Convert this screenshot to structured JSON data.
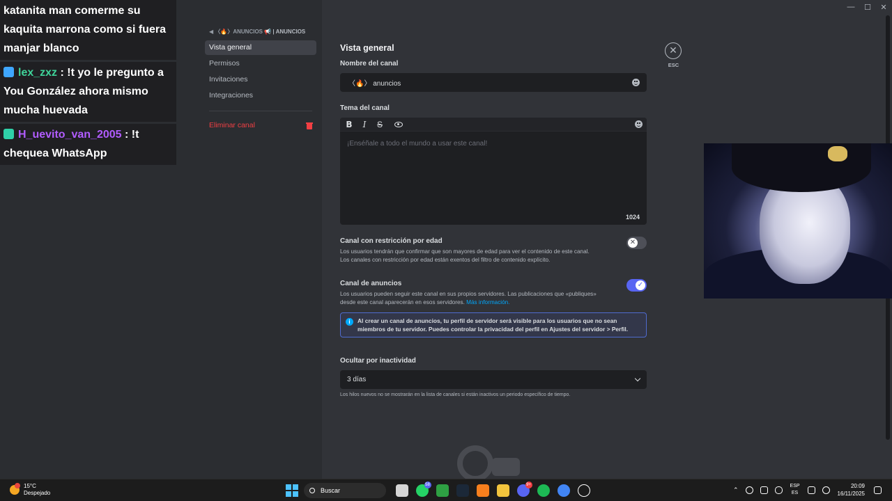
{
  "chat": [
    {
      "user": "",
      "user_color": "#ffffff",
      "badge_color": "",
      "text": "katanita man comerme su kaquita marrona como si fuera manjar blanco"
    },
    {
      "user": "lex_zxz",
      "user_color": "#3fd49a",
      "badge_color": "#3fa7ff",
      "text": "!t yo le pregunto a You González ahora mismo mucha huevada"
    },
    {
      "user": "H_uevito_van_2005",
      "user_color": "#b15cff",
      "badge_color": "#2fd1a8",
      "text": "!t chequea WhatsApp"
    }
  ],
  "sidebar": {
    "category_prefix": "◀ 〈🔥〉ANUNCIOS",
    "category_channel": "📢 | ANUNCIOS",
    "items": [
      {
        "label": "Vista general",
        "active": true
      },
      {
        "label": "Permisos",
        "active": false
      },
      {
        "label": "Invitaciones",
        "active": false
      },
      {
        "label": "Integraciones",
        "active": false
      }
    ],
    "delete_label": "Eliminar canal"
  },
  "main": {
    "title": "Vista general",
    "name_label": "Nombre del canal",
    "name_value": "〈🔥〉 anuncios",
    "topic_label": "Tema del canal",
    "topic_placeholder": "¡Enséñale a todo el mundo a usar este canal!",
    "topic_counter": "1024",
    "age_title": "Canal con restricción por edad",
    "age_desc": "Los usuarios tendrán que confirmar que son mayores de edad para ver el contenido de este canal. Los canales con restricción por edad están exentos del filtro de contenido explícito.",
    "age_enabled": false,
    "news_title": "Canal de anuncios",
    "news_desc": "Los usuarios pueden seguir este canal en sus propios servidores. Las publicaciones que «publiques» desde este canal aparecerán en esos servidores.",
    "news_link": "Más información.",
    "news_enabled": true,
    "info_text": "Al crear un canal de anuncios, tu perfil de servidor será visible para los usuarios que no sean miembros de tu servidor. Puedes controlar la privacidad del perfil en Ajustes del servidor > Perfil.",
    "inactivity_label": "Ocultar por inactividad",
    "inactivity_value": "3 días",
    "inactivity_note": "Los hilos nuevos no se mostrarán en la lista de canales si están inactivos un periodo específico de tiempo."
  },
  "esc_label": "ESC",
  "taskbar": {
    "weather_temp": "15°C",
    "weather_desc": "Despejado",
    "search_label": "Buscar",
    "whatsapp_badge": "58",
    "discord_badge": "9+",
    "lang_top": "ESP",
    "lang_bottom": "ES",
    "time": "20:09",
    "date": "16/11/2025"
  },
  "colors": {
    "accent": "#5865f2",
    "danger": "#f23f43",
    "link": "#00a8fc"
  }
}
